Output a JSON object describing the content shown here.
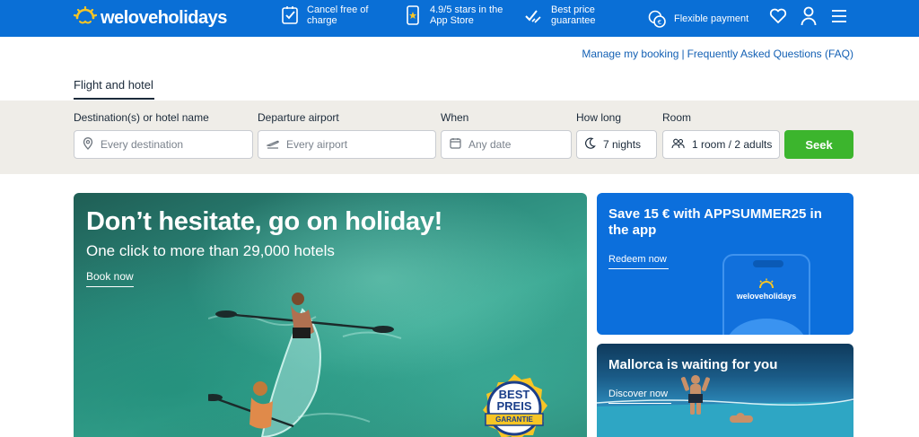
{
  "brand": {
    "name": "weloveholidays"
  },
  "header": {
    "features": [
      {
        "icon": "checkbox-icon",
        "text": "Cancel free of charge"
      },
      {
        "icon": "phone-star-icon",
        "text": "4.9/5 stars in the App Store"
      },
      {
        "icon": "thumbs-up-icon",
        "text": "Best price guarantee"
      },
      {
        "icon": "coins-icon",
        "text": "Flexible payment"
      }
    ],
    "icons": [
      "heart-icon",
      "user-icon",
      "menu-icon"
    ]
  },
  "top_links": {
    "manage_booking": "Manage my booking",
    "separator": "|",
    "faq": "Frequently Asked Questions (FAQ)"
  },
  "tabs": {
    "active": "Flight and hotel"
  },
  "search": {
    "destination": {
      "label": "Destination(s) or hotel name",
      "placeholder": "Every destination"
    },
    "departure": {
      "label": "Departure airport",
      "placeholder": "Every airport"
    },
    "when": {
      "label": "When",
      "placeholder": "Any date"
    },
    "how_long": {
      "label": "How long",
      "value": "7 nights"
    },
    "room": {
      "label": "Room",
      "value": "1 room / 2 adults"
    },
    "submit": "Seek"
  },
  "hero": {
    "title": "Don’t hesitate, go on holiday!",
    "subtitle": "One click to more than 29,000 hotels",
    "cta": "Book now",
    "badge": {
      "line1": "BEST",
      "line2": "PREIS",
      "line3": "GARANTIE"
    }
  },
  "promo_app": {
    "title": "Save 15 € with APPSUMMER25 in the app",
    "cta": "Redeem now",
    "phone_logo": "weloveholidays"
  },
  "promo_mallorca": {
    "title": "Mallorca is waiting for you",
    "cta": "Discover now"
  },
  "colors": {
    "header": "#0a6fd6",
    "search_bg": "#efede8",
    "seek": "#3cb52d",
    "link": "#1360b4"
  }
}
